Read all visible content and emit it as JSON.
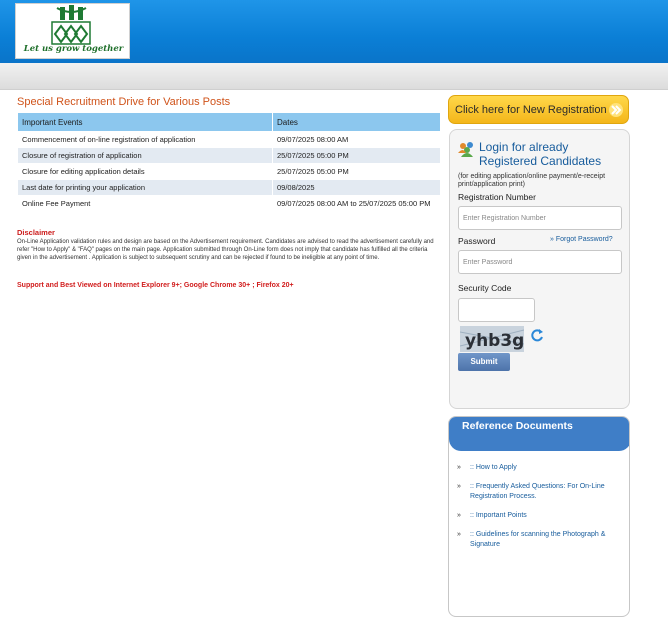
{
  "header": {
    "logo_tagline": "Let us grow together",
    "logo_text_left": "ఎన్ ఎఫ్ ఎల్",
    "logo_text_right": "एन एफ एल"
  },
  "main": {
    "section_title": "Special Recruitment Drive for Various Posts",
    "table": {
      "headers": [
        "Important Events",
        "Dates"
      ],
      "rows": [
        [
          "Commencement of on-line registration of application",
          "09/07/2025 08:00 AM"
        ],
        [
          "Closure of registration of application",
          "25/07/2025 05:00 PM"
        ],
        [
          "Closure for editing application details",
          "25/07/2025 05:00 PM"
        ],
        [
          "Last date for printing your application",
          "09/08/2025"
        ],
        [
          "Online Fee Payment",
          "09/07/2025 08:00 AM to 25/07/2025 05:00 PM"
        ]
      ]
    },
    "disclaimer_title": "Disclaimer",
    "disclaimer_text": "On-Line Application validation rules and design are based on the Advertisement requirement. Candidates are advised to read the advertisement carefully and refer \"How to Apply\" & \"FAQ\" pages on the main page. Application submitted through On-Line form does not imply that candidate has fulfilled all the criteria given in the advertisement . Application is subject to subsequent scrutiny and can be rejected if found to be ineligible at any point of time.",
    "support_text": "Support and Best Viewed on Internet Explorer 9+; Google Chrome 30+ ; Firefox 20+"
  },
  "registration": {
    "button_label": "Click here for New Registration"
  },
  "login": {
    "title": "Login for already Registered Candidates",
    "note": "(for editing application/online payment/e-receipt print/application print)",
    "reg_number_label": "Registration Number",
    "reg_number_placeholder": "Enter Registration Number",
    "password_label": "Password",
    "forgot_label": "Forgot Password?",
    "password_placeholder": "Enter Password",
    "security_code_label": "Security Code",
    "captcha_text": "yhb3g",
    "submit_label": "Submit"
  },
  "reference": {
    "title": "Reference Documents",
    "items": [
      ":: How to Apply",
      ":: Frequently Asked Questions: For On-Line Registration Process.",
      ":: Important Points",
      ":: Guidelines for scanning the Photograph & Signature"
    ]
  },
  "colors": {
    "header_blue": "#0b7fd6",
    "accent_orange": "#d0531a",
    "button_yellow": "#f4b61a",
    "link_blue": "#175c9c",
    "alert_red": "#cc1b1b"
  }
}
